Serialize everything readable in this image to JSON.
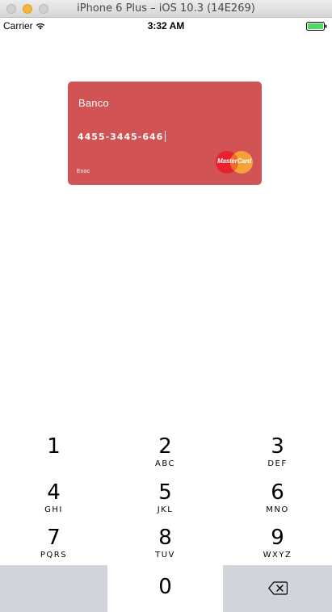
{
  "window": {
    "title": "iPhone 6 Plus – iOS 10.3 (14E269)",
    "buttons": [
      "close-icon",
      "minimize-icon",
      "zoom-icon"
    ]
  },
  "status_bar": {
    "carrier": "Carrier",
    "wifi_icon": "wifi-icon",
    "time": "3:32 AM",
    "battery_icon": "battery-icon",
    "battery_color": "#4cd964"
  },
  "card": {
    "bank": "Banco",
    "number": "4455-3445-646",
    "holder": "Enoc",
    "brand": "MasterCard",
    "brand_icon": "mastercard-icon",
    "background_color": "#d15354"
  },
  "keypad": {
    "keys": [
      {
        "digit": "1",
        "letters": ""
      },
      {
        "digit": "2",
        "letters": "ABC"
      },
      {
        "digit": "3",
        "letters": "DEF"
      },
      {
        "digit": "4",
        "letters": "GHI"
      },
      {
        "digit": "5",
        "letters": "JKL"
      },
      {
        "digit": "6",
        "letters": "MNO"
      },
      {
        "digit": "7",
        "letters": "PQRS"
      },
      {
        "digit": "8",
        "letters": "TUV"
      },
      {
        "digit": "9",
        "letters": "WXYZ"
      }
    ],
    "zero": "0",
    "delete_icon": "delete-backspace-icon",
    "key_background": "#ffffff",
    "function_key_background": "#d1d5db"
  }
}
